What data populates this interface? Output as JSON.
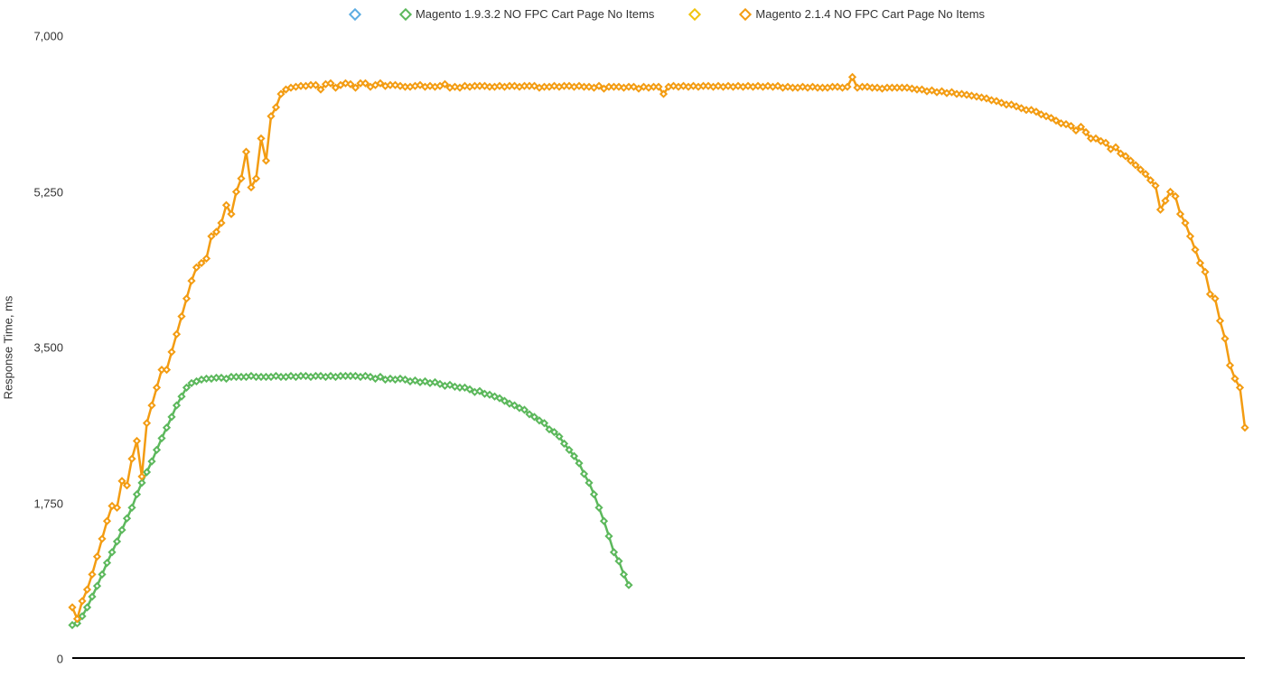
{
  "chart_data": {
    "type": "line",
    "ylabel": "Response Time, ms",
    "xlabel": "",
    "ylim": [
      0,
      7000
    ],
    "yticks": [
      0,
      1750,
      3500,
      5250,
      7000
    ],
    "ytick_labels": [
      "0",
      "1,750",
      "3,500",
      "5,250",
      "7,000"
    ],
    "legend_entries": [
      {
        "label": "",
        "color": "#5DADE2"
      },
      {
        "label": "Magento 1.9.3.2 NO FPC Cart Page No Items",
        "color": "#5CB85C"
      },
      {
        "label": "",
        "color": "#F1C40F"
      },
      {
        "label": "Magento 2.1.4 NO FPC Cart Page No Items",
        "color": "#F39C12"
      }
    ],
    "series": [
      {
        "name": "Magento 1.9.3.2 NO FPC Cart Page No Items",
        "color": "#5CB85C",
        "values": [
          380,
          400,
          480,
          580,
          700,
          820,
          950,
          1080,
          1200,
          1320,
          1450,
          1580,
          1700,
          1850,
          1980,
          2100,
          2220,
          2350,
          2480,
          2600,
          2720,
          2850,
          2950,
          3050,
          3100,
          3120,
          3140,
          3150,
          3150,
          3160,
          3160,
          3150,
          3170,
          3170,
          3170,
          3170,
          3180,
          3170,
          3170,
          3170,
          3170,
          3180,
          3170,
          3170,
          3180,
          3170,
          3180,
          3180,
          3170,
          3180,
          3180,
          3170,
          3180,
          3170,
          3180,
          3180,
          3180,
          3180,
          3170,
          3180,
          3170,
          3150,
          3170,
          3140,
          3150,
          3140,
          3150,
          3140,
          3120,
          3130,
          3110,
          3120,
          3100,
          3110,
          3090,
          3070,
          3080,
          3060,
          3050,
          3050,
          3030,
          3000,
          3010,
          2980,
          2970,
          2950,
          2930,
          2900,
          2870,
          2850,
          2820,
          2800,
          2750,
          2720,
          2680,
          2650,
          2580,
          2550,
          2500,
          2420,
          2350,
          2280,
          2200,
          2080,
          1980,
          1850,
          1700,
          1550,
          1380,
          1200,
          1100,
          950,
          830
        ]
      },
      {
        "name": "Magento 2.1.4 NO FPC Cart Page No Items",
        "color": "#F39C12",
        "values": [
          580,
          450,
          650,
          780,
          950,
          1150,
          1350,
          1550,
          1720,
          1700,
          2000,
          1950,
          2250,
          2450,
          2050,
          2650,
          2850,
          3050,
          3250,
          3250,
          3450,
          3650,
          3850,
          4050,
          4250,
          4400,
          4450,
          4500,
          4750,
          4800,
          4900,
          5100,
          5000,
          5250,
          5400,
          5700,
          5300,
          5400,
          5850,
          5600,
          6100,
          6200,
          6350,
          6400,
          6420,
          6430,
          6440,
          6440,
          6450,
          6450,
          6400,
          6460,
          6470,
          6420,
          6450,
          6470,
          6460,
          6420,
          6470,
          6470,
          6430,
          6450,
          6470,
          6440,
          6450,
          6450,
          6440,
          6430,
          6430,
          6440,
          6450,
          6430,
          6440,
          6430,
          6440,
          6460,
          6420,
          6430,
          6420,
          6440,
          6430,
          6440,
          6440,
          6440,
          6430,
          6430,
          6440,
          6430,
          6440,
          6440,
          6430,
          6440,
          6440,
          6440,
          6420,
          6430,
          6430,
          6440,
          6430,
          6440,
          6440,
          6430,
          6440,
          6430,
          6430,
          6420,
          6440,
          6410,
          6430,
          6430,
          6430,
          6420,
          6430,
          6430,
          6410,
          6430,
          6420,
          6430,
          6430,
          6350,
          6430,
          6440,
          6430,
          6440,
          6430,
          6440,
          6430,
          6440,
          6440,
          6430,
          6440,
          6430,
          6440,
          6430,
          6440,
          6430,
          6440,
          6430,
          6440,
          6430,
          6440,
          6430,
          6440,
          6420,
          6430,
          6420,
          6420,
          6430,
          6420,
          6430,
          6420,
          6420,
          6420,
          6430,
          6430,
          6420,
          6430,
          6540,
          6420,
          6430,
          6430,
          6420,
          6420,
          6410,
          6420,
          6420,
          6420,
          6420,
          6420,
          6410,
          6400,
          6400,
          6380,
          6390,
          6370,
          6380,
          6360,
          6370,
          6350,
          6350,
          6340,
          6330,
          6320,
          6310,
          6300,
          6280,
          6270,
          6250,
          6230,
          6230,
          6210,
          6190,
          6170,
          6170,
          6150,
          6120,
          6100,
          6080,
          6050,
          6020,
          6010,
          5990,
          5940,
          5980,
          5920,
          5850,
          5850,
          5820,
          5800,
          5730,
          5750,
          5680,
          5650,
          5600,
          5550,
          5500,
          5450,
          5380,
          5320,
          5050,
          5150,
          5250,
          5200,
          5000,
          4900,
          4750,
          4600,
          4450,
          4350,
          4100,
          4050,
          3800,
          3600,
          3300,
          3150,
          3050,
          2600
        ]
      }
    ]
  }
}
